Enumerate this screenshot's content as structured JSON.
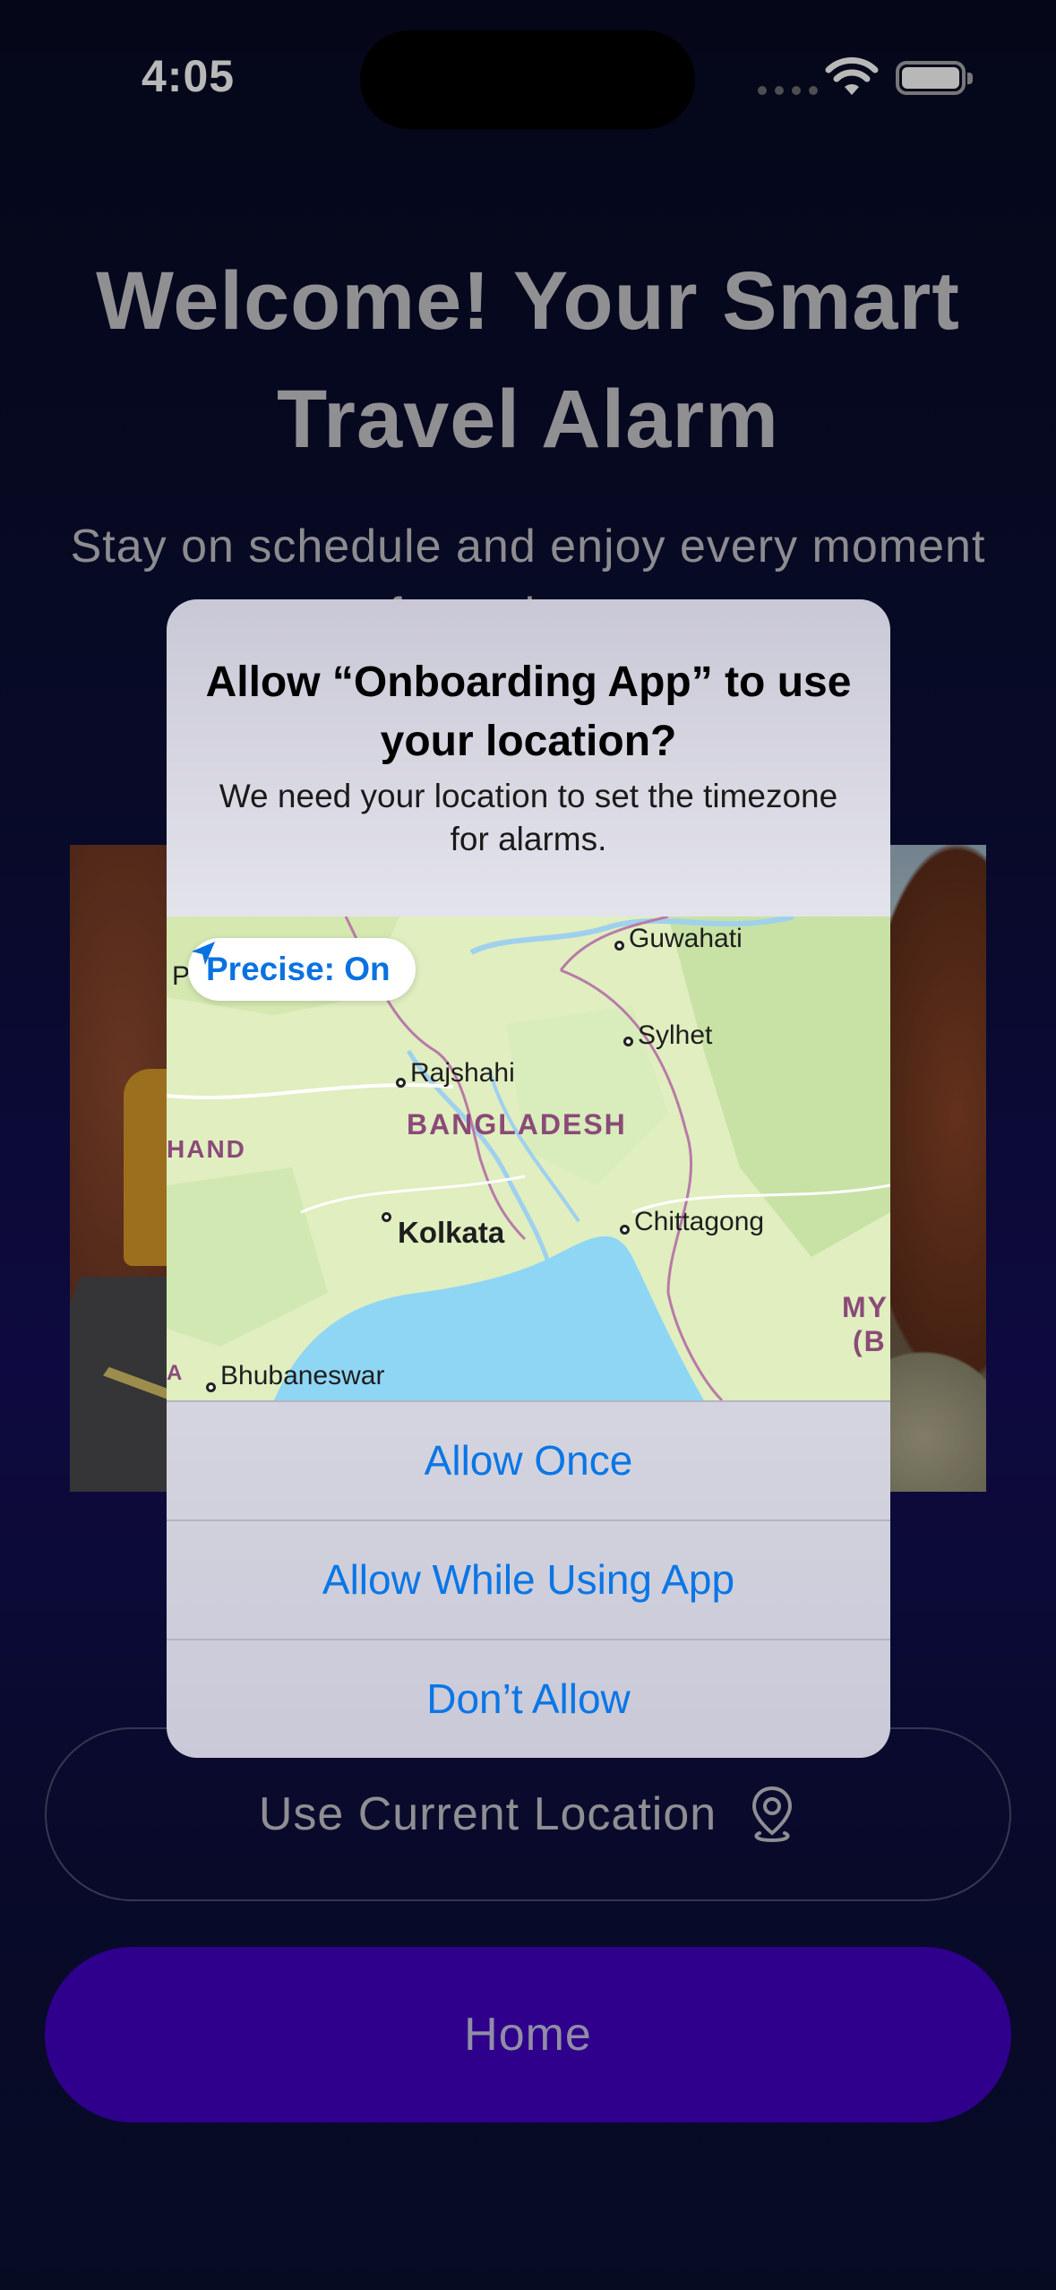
{
  "status_bar": {
    "time": "4:05"
  },
  "welcome": {
    "title": "Welcome! Your Smart Travel Alarm",
    "subtitle": "Stay on schedule and enjoy every moment of your journey."
  },
  "buttons": {
    "use_location": "Use Current Location",
    "home": "Home"
  },
  "alert": {
    "title": "Allow “Onboarding App” to use your location?",
    "message": "We need your location to set the timezone for alarms.",
    "precise_label": "Precise: On",
    "actions": [
      "Allow Once",
      "Allow While Using App",
      "Don’t Allow"
    ],
    "map": {
      "cities": [
        "Guwahati",
        "Sylhet",
        "Rajshahi",
        "Kolkata",
        "Chittagong",
        "Bhubaneswar",
        "P"
      ],
      "countries": [
        "BANGLADESH",
        "HAND",
        "MY",
        "(B",
        "A"
      ]
    }
  },
  "colors": {
    "accent": "#4000c2",
    "link_blue": "#0a76e6",
    "background": "#0c0f38"
  }
}
